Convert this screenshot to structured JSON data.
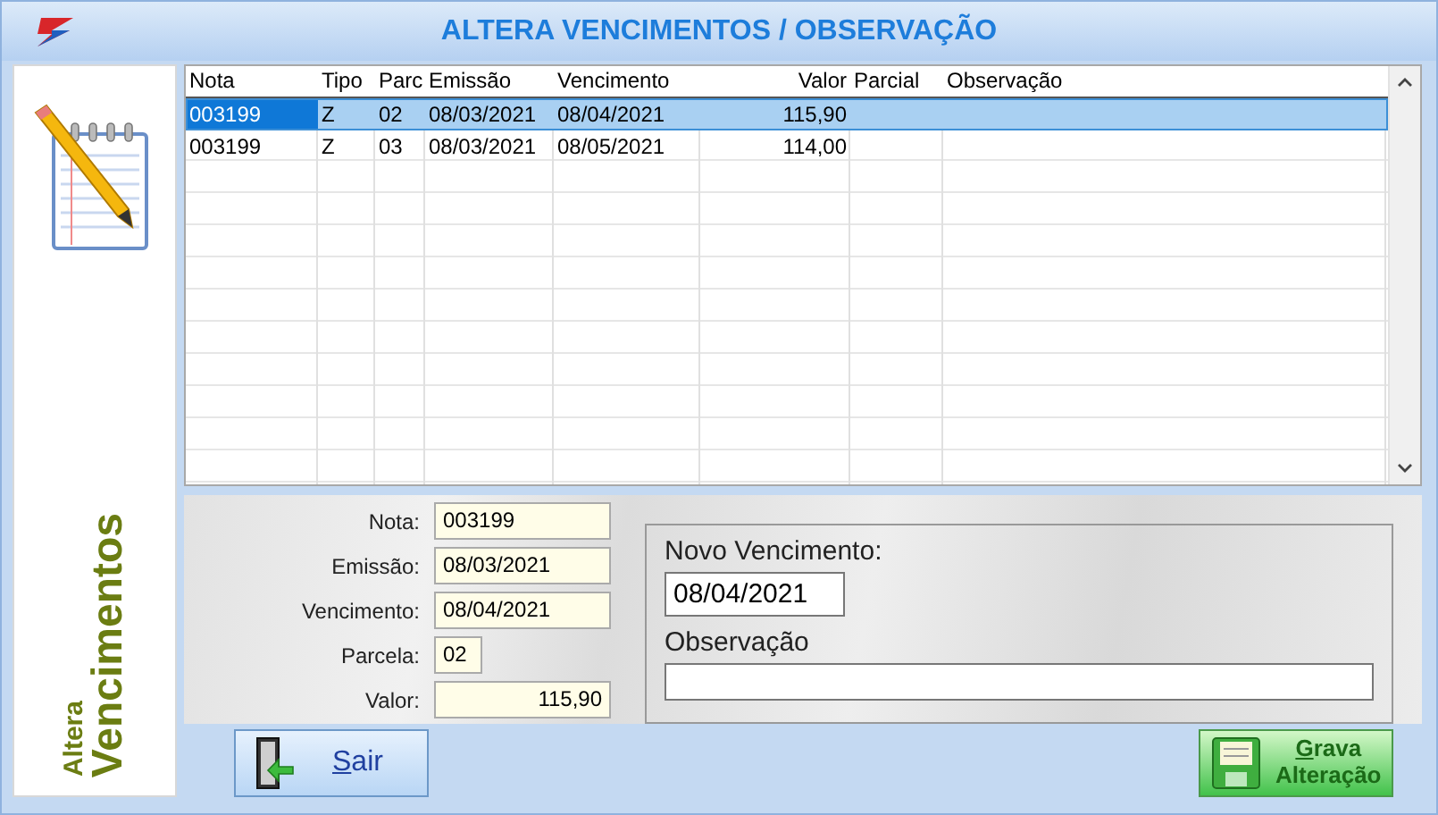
{
  "window": {
    "title": "ALTERA VENCIMENTOS / OBSERVAÇÃO"
  },
  "side_label": {
    "small": "Altera",
    "large": "Vencimentos"
  },
  "table": {
    "columns": [
      {
        "label": "Nota",
        "kind": "text"
      },
      {
        "label": "Tipo",
        "kind": "text"
      },
      {
        "label": "Parc",
        "kind": "text"
      },
      {
        "label": "Emissão",
        "kind": "text"
      },
      {
        "label": "Vencimento",
        "kind": "text"
      },
      {
        "label": "Valor",
        "kind": "amount"
      },
      {
        "label": "Parcial",
        "kind": "text"
      },
      {
        "label": "Observação",
        "kind": "text"
      }
    ],
    "rows": [
      {
        "selected": true,
        "cells": [
          "003199",
          "Z",
          "02",
          "08/03/2021",
          "08/04/2021",
          "115,90"
        ]
      },
      {
        "selected": false,
        "cells": [
          "003199",
          "Z",
          "03",
          "08/03/2021",
          "08/05/2021",
          "114,00"
        ]
      }
    ]
  },
  "form": {
    "fields": [
      {
        "label": "Nota:",
        "value": "003199",
        "kind": "text"
      },
      {
        "label": "Emissão:",
        "value": "08/03/2021",
        "kind": "text"
      },
      {
        "label": "Vencimento:",
        "value": "08/04/2021",
        "kind": "text"
      },
      {
        "label": "Parcela:",
        "value": "02",
        "kind": "short"
      },
      {
        "label": "Valor:",
        "value": "115,90",
        "kind": "amount"
      }
    ],
    "new_due": {
      "label": "Novo Vencimento:",
      "value": "08/04/2021"
    },
    "note": {
      "label": "Observação"
    }
  },
  "buttons": [
    {
      "kind": "exit",
      "label": "Sair",
      "underline_first": true
    },
    {
      "kind": "save",
      "label": "Grava Alteração",
      "underline_first": true
    }
  ]
}
